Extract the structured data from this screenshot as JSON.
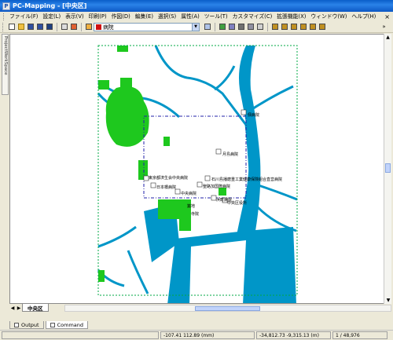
{
  "app": {
    "title": "PC-Mapping - [中央区]"
  },
  "menu": [
    "ファイル(F)",
    "設定(L)",
    "表示(V)",
    "印刷(P)",
    "作図(D)",
    "編集(E)",
    "選択(S)",
    "属性(A)",
    "ツール(T)",
    "カスタマイズ(C)",
    "拡張機能(X)",
    "ウィンドウ(W)",
    "ヘルプ(H)"
  ],
  "menu_close": "×",
  "layer_combo": {
    "value": "病院",
    "swatch_color": "#d01010"
  },
  "side_panel": {
    "label": "ProjectWorkSpace"
  },
  "map": {
    "labels": [
      "聖路加国際病院",
      "石川島播磨重工業健康保険組合直営病院",
      "中央病院",
      "浜町病院",
      "築地",
      "寺院",
      "月島病院",
      "佃病院",
      "日本橋病院",
      "東京都済生会中央病院",
      "中央区役所"
    ],
    "colors": {
      "water": "#0096c8",
      "green": "#1ec81e",
      "frame": "#00aa44",
      "selection": "#2020aa",
      "background": "#ffffff"
    }
  },
  "doc_tab": "中央区",
  "bottom_tabs": [
    "Output",
    "Command"
  ],
  "status": {
    "xy_mm": "-107.41 112.89 (mm)",
    "coords": "-34,812.73 -9,315.13 (m)",
    "scale": "1 / 48,976"
  }
}
